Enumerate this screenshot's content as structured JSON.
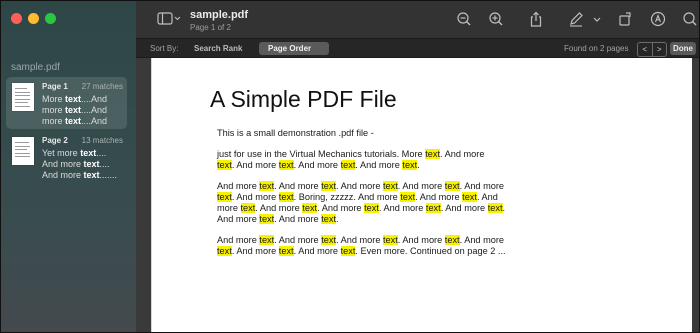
{
  "window": {
    "traffic_colors": [
      "#ff5f57",
      "#febc2e",
      "#28c840"
    ]
  },
  "sidebar": {
    "title": "sample.pdf",
    "pages": [
      {
        "label": "Page 1",
        "matches": "27 matches",
        "snippet": [
          [
            "More ",
            "text",
            "....And"
          ],
          [
            "more ",
            "text",
            "....And"
          ],
          [
            "more ",
            "text",
            "....And"
          ]
        ],
        "selected": true
      },
      {
        "label": "Page 2",
        "matches": "13 matches",
        "snippet": [
          [
            "Yet more ",
            "text",
            "...."
          ],
          [
            "And more ",
            "text",
            "...."
          ],
          [
            "And more ",
            "text",
            "......."
          ]
        ],
        "selected": false
      }
    ]
  },
  "toolbar": {
    "sidebar_icon": "sidebar-toggle-icon",
    "doc_title": "sample.pdf",
    "doc_subtitle": "Page 1 of 2",
    "icons": [
      "zoom-out-icon",
      "zoom-in-icon",
      "share-icon",
      "markup-pen-icon",
      "chevron-down-icon",
      "rotate-icon",
      "annotate-icon",
      "search-icon"
    ]
  },
  "search_bar": {
    "sort_label": "Sort By:",
    "options": [
      "Search Rank",
      "Page Order"
    ],
    "active_option": "Page Order",
    "found_text": "Found on 2 pages",
    "prev_label": "<",
    "next_label": ">",
    "done_label": "Done"
  },
  "document": {
    "title": "A Simple PDF File",
    "paragraphs": [
      [
        [
          "This is a small demonstration .pdf file -"
        ]
      ],
      [
        [
          "just for use in the Virtual Mechanics tutorials. More ",
          {
            "h": "text"
          },
          ". And more"
        ],
        [
          {
            "h": "text"
          },
          ". And more ",
          {
            "h": "text"
          },
          ". And more ",
          {
            "h": "text"
          },
          ". And more ",
          {
            "h": "text"
          },
          "."
        ]
      ],
      [
        [
          "And more ",
          {
            "h": "text"
          },
          ". And more ",
          {
            "h": "text"
          },
          ". And more ",
          {
            "h": "text"
          },
          ". And more ",
          {
            "h": "text"
          },
          ". And more"
        ],
        [
          {
            "h": "text"
          },
          ". And more ",
          {
            "h": "text"
          },
          ". Boring, zzzzz. And more ",
          {
            "h": "text"
          },
          ". And more ",
          {
            "h": "text"
          },
          ". And"
        ],
        [
          "more ",
          {
            "h": "text"
          },
          ". And more ",
          {
            "h": "text"
          },
          ". And more ",
          {
            "h": "text"
          },
          ". And more ",
          {
            "h": "text"
          },
          ". And more ",
          {
            "h": "text"
          },
          "."
        ],
        [
          "And more ",
          {
            "h": "text"
          },
          ". And more ",
          {
            "h": "text"
          },
          "."
        ]
      ],
      [
        [
          "And more ",
          {
            "h": "text"
          },
          ". And more ",
          {
            "h": "text"
          },
          ". And more ",
          {
            "h": "text"
          },
          ". And more ",
          {
            "h": "text"
          },
          ". And more"
        ],
        [
          {
            "h": "text"
          },
          ". And more ",
          {
            "h": "text"
          },
          ". And more ",
          {
            "h": "text"
          },
          ". Even more. Continued on page 2 ..."
        ]
      ]
    ],
    "highlight_color": "#f7f300"
  }
}
